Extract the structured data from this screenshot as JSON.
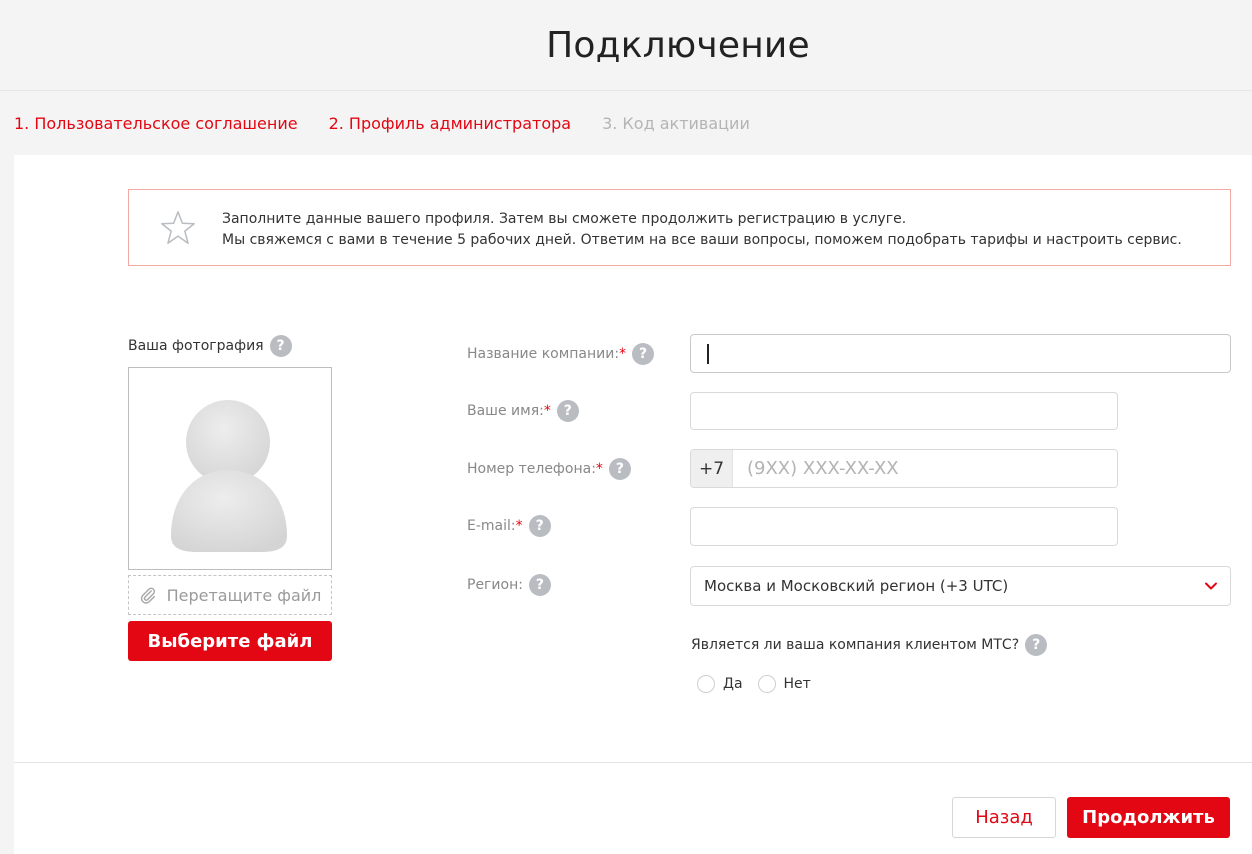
{
  "header": {
    "title": "Подключение"
  },
  "steps": [
    {
      "label": "1. Пользовательское соглашение",
      "state": "done"
    },
    {
      "label": "2. Профиль администратора",
      "state": "current"
    },
    {
      "label": "3. Код активации",
      "state": "pending"
    }
  ],
  "notice": {
    "icon": "star-outline-icon",
    "line1": "Заполните данные вашего профиля. Затем вы сможете продолжить регистрацию в услуге.",
    "line2": "Мы свяжемся с вами в течение 5 рабочих дней. Ответим на все ваши вопросы, поможем подобрать тарифы и настроить сервис."
  },
  "photo": {
    "label": "Ваша фотография",
    "help": "?",
    "drop_text": "Перетащите файл",
    "choose_button": "Выберите файл"
  },
  "form": {
    "company": {
      "label": "Название компании:",
      "required": "*",
      "help": "?",
      "value": ""
    },
    "name": {
      "label": "Ваше имя:",
      "required": "*",
      "help": "?",
      "value": ""
    },
    "phone": {
      "label": "Номер телефона:",
      "required": "*",
      "help": "?",
      "prefix": "+7",
      "placeholder": "(9XX) XXX-XX-XX"
    },
    "email": {
      "label": "E-mail:",
      "required": "*",
      "help": "?",
      "value": ""
    },
    "region": {
      "label": "Регион:",
      "help": "?",
      "selected": "Москва и Московский регион (+3 UTC)"
    },
    "client_question": {
      "label": "Является ли ваша компания клиентом МТС?",
      "help": "?",
      "options": [
        "Да",
        "Нет"
      ]
    }
  },
  "actions": {
    "back": "Назад",
    "next": "Продолжить"
  },
  "colors": {
    "accent": "#e30613",
    "inactive_step": "#b4b4b4",
    "notice_border": "#f2a9a2"
  }
}
